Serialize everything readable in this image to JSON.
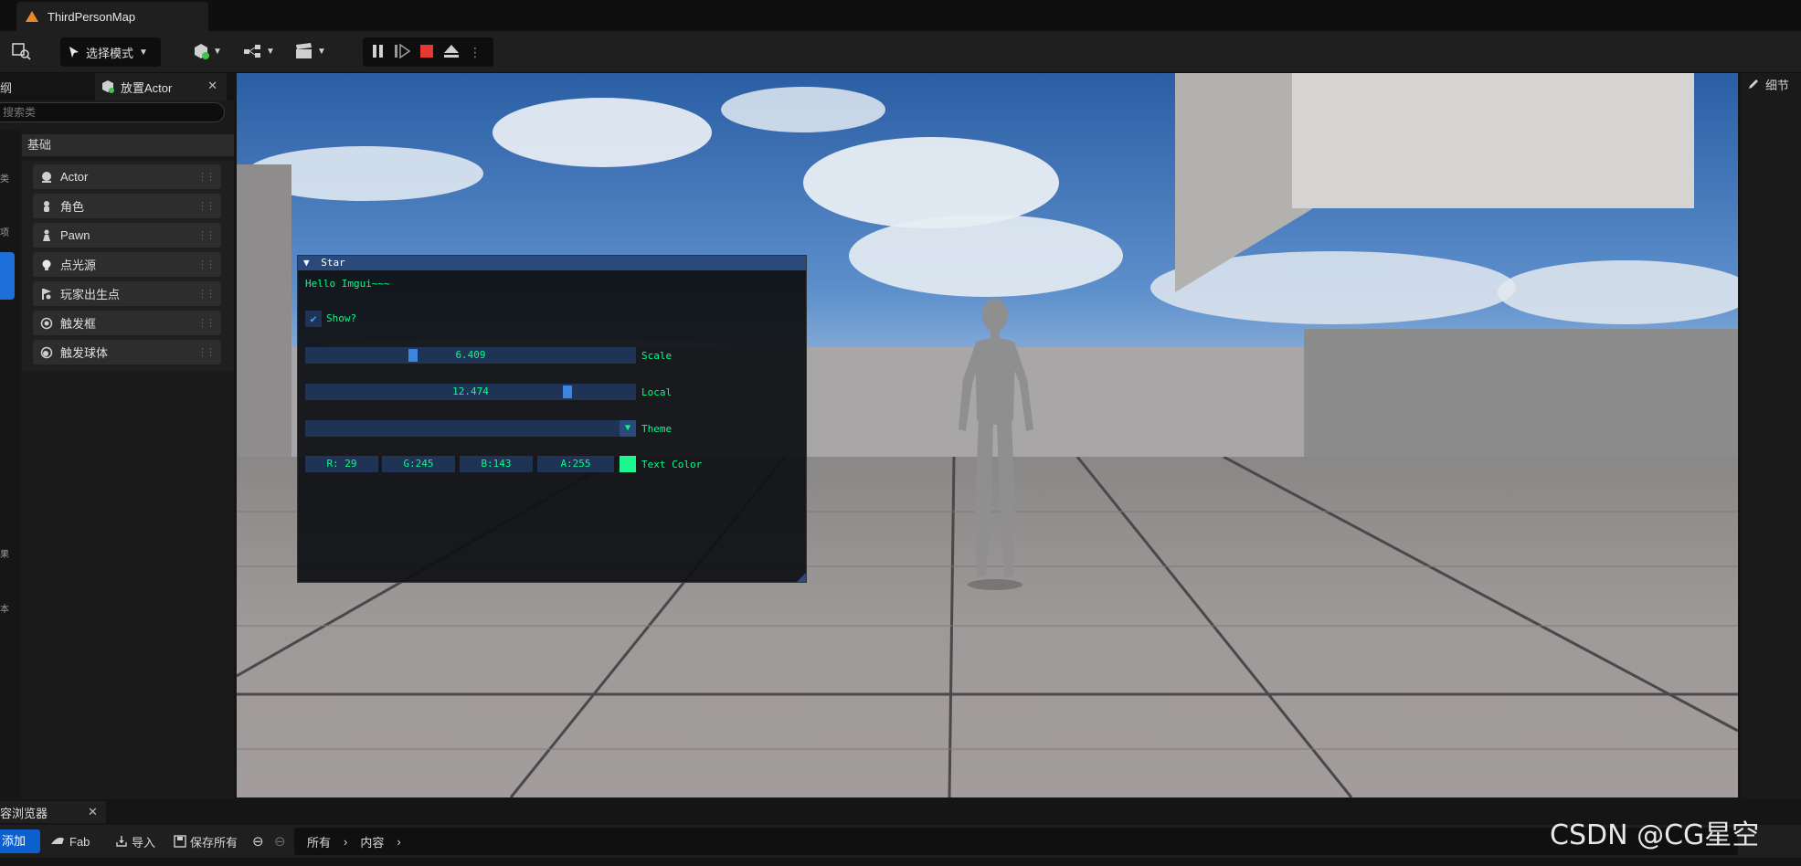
{
  "window": {
    "tab_title": "ThirdPersonMap"
  },
  "toolbar": {
    "mode_label": "选择模式"
  },
  "left_panel": {
    "outline_tab_label": "纲",
    "place_actor_tab_label": "放置Actor",
    "search_placeholder": "搜索类",
    "category_header": "基础",
    "side_letters": [
      "类",
      "项",
      "果",
      "本"
    ],
    "items": [
      {
        "label": "Actor",
        "icon": "sphere-icon"
      },
      {
        "label": "角色",
        "icon": "character-icon"
      },
      {
        "label": "Pawn",
        "icon": "pawn-icon"
      },
      {
        "label": "点光源",
        "icon": "point-light-icon"
      },
      {
        "label": "玩家出生点",
        "icon": "player-start-icon"
      },
      {
        "label": "触发框",
        "icon": "trigger-box-icon"
      },
      {
        "label": "触发球体",
        "icon": "trigger-sphere-icon"
      }
    ]
  },
  "imgui": {
    "title": "Star",
    "hello_text": "Hello Imgui~~~",
    "show_label": "Show?",
    "show_checked": true,
    "scale": {
      "label": "Scale",
      "value": "6.409",
      "fraction": 0.32
    },
    "local": {
      "label": "Local",
      "value": "12.474",
      "fraction": 0.8
    },
    "theme_label": "Theme",
    "color": {
      "label": "Text Color",
      "r": "R: 29",
      "g": "G:245",
      "b": "B:143",
      "a": "A:255",
      "hex": "#1df58f"
    }
  },
  "right_panel": {
    "details_label": "细节"
  },
  "content_browser": {
    "tab_label": "容浏览器",
    "add_label": "添加",
    "fab_label": "Fab",
    "import_label": "导入",
    "save_all_label": "保存所有",
    "crumbs": [
      "所有",
      "内容"
    ]
  },
  "watermark": "CSDN @CG星空",
  "colors": {
    "accent": "#1e6fd9",
    "imgui_text": "#00ff87",
    "imgui_title": "#294a7a",
    "stop_red": "#e53935"
  }
}
